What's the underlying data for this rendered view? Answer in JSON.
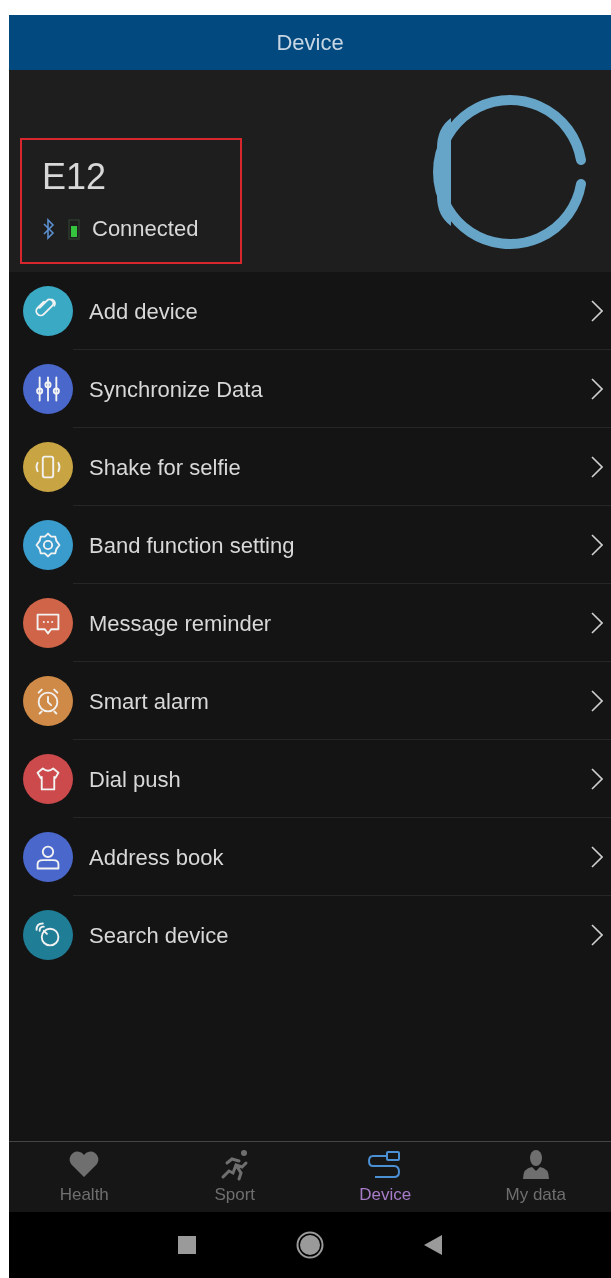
{
  "header": {
    "title": "Device"
  },
  "device": {
    "name": "E12",
    "status": "Connected",
    "highlighted": true
  },
  "menu": [
    {
      "label": "Add device",
      "kind": "link",
      "color": "#3aa9c4"
    },
    {
      "label": "Synchronize Data",
      "kind": "sliders",
      "color": "#4a68cc"
    },
    {
      "label": "Shake for selfie",
      "kind": "phone",
      "color": "#c9a443"
    },
    {
      "label": "Band function setting",
      "kind": "gear",
      "color": "#3a9ccc"
    },
    {
      "label": "Message reminder",
      "kind": "message",
      "color": "#cf6448"
    },
    {
      "label": "Smart alarm",
      "kind": "alarm",
      "color": "#cf8a48"
    },
    {
      "label": "Dial push",
      "kind": "shirt",
      "color": "#cc4a4c"
    },
    {
      "label": "Address book",
      "kind": "person",
      "color": "#4a68cc"
    },
    {
      "label": "Search device",
      "kind": "search",
      "color": "#1f7d96"
    }
  ],
  "tabs": [
    {
      "label": "Health",
      "kind": "heart",
      "selected": false
    },
    {
      "label": "Sport",
      "kind": "runner",
      "selected": false
    },
    {
      "label": "Device",
      "kind": "cable",
      "selected": true
    },
    {
      "label": "My data",
      "kind": "user",
      "selected": false
    }
  ]
}
